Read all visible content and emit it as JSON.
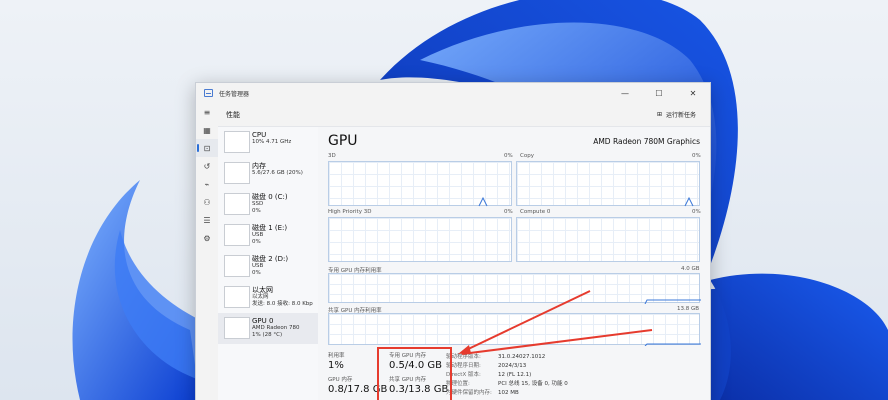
{
  "window": {
    "title": "任务管理器",
    "minimize_icon": "minimize-icon",
    "maximize_icon": "maximize-icon",
    "close_icon": "close-icon"
  },
  "header": {
    "title": "性能",
    "run_task_label": "运行新任务"
  },
  "sidebar": {
    "items": [
      {
        "name": "CPU",
        "line1": "10% 4.71 GHz",
        "line2": ""
      },
      {
        "name": "内存",
        "line1": "5.6/27.6 GB (20%)",
        "line2": ""
      },
      {
        "name": "磁盘 0 (C:)",
        "line1": "SSD",
        "line2": "0%"
      },
      {
        "name": "磁盘 1 (E:)",
        "line1": "USB",
        "line2": "0%"
      },
      {
        "name": "磁盘 2 (D:)",
        "line1": "USB",
        "line2": "0%"
      },
      {
        "name": "以太网",
        "line1": "以太网",
        "line2": "发送: 8.0 接收: 8.0 Kbp"
      },
      {
        "name": "GPU 0",
        "line1": "AMD Radeon 780",
        "line2": "1% (28 °C)"
      }
    ]
  },
  "main": {
    "title": "GPU",
    "device": "AMD Radeon 780M Graphics",
    "graphs": {
      "g3d": {
        "label": "3D",
        "pct": "0%"
      },
      "copy": {
        "label": "Copy",
        "pct": "0%"
      },
      "hp3d": {
        "label": "High Priority 3D",
        "pct": "0%"
      },
      "compute": {
        "label": "Compute 0",
        "pct": "0%"
      },
      "dedicated": {
        "label": "专用 GPU 内存利用率",
        "max": "4.0 GB"
      },
      "shared": {
        "label": "共享 GPU 内存利用率",
        "max": "13.8 GB"
      }
    },
    "stats": {
      "util_label": "利用率",
      "util_value": "1%",
      "gpu_mem_label": "GPU 内存",
      "gpu_mem_value": "0.8/17.8 GB",
      "ded_label": "专用 GPU 内存",
      "ded_value": "0.5/4.0 GB",
      "shared_label": "共享 GPU 内存",
      "shared_value": "0.3/13.8 GB"
    },
    "details": {
      "driver_ver_k": "驱动程序版本:",
      "driver_ver_v": "31.0.24027.1012",
      "driver_date_k": "驱动程序日期:",
      "driver_date_v": "2024/3/13",
      "dx_k": "DirectX 版本:",
      "dx_v": "12 (FL 12.1)",
      "loc_k": "物理位置:",
      "loc_v": "PCI 总线 15, 设备 0, 功能 0",
      "res_k": "为硬件保留的内存:",
      "res_v": "102 MB"
    }
  },
  "colors": {
    "accent": "#2c6fd6",
    "annotation": "#e63b2e"
  }
}
